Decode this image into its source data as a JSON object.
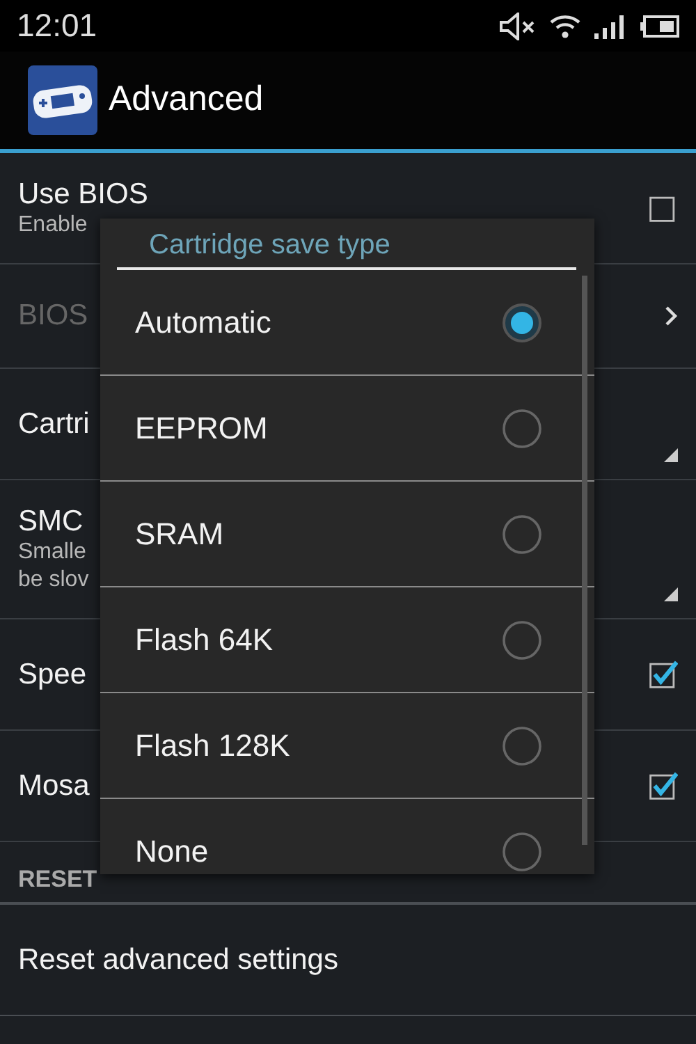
{
  "status_bar": {
    "time": "12:01"
  },
  "action_bar": {
    "title": "Advanced"
  },
  "settings": [
    {
      "kind": "checkbox",
      "title": "Use BIOS",
      "summary": [
        "Enable"
      ],
      "checked": false,
      "disabled": false
    },
    {
      "kind": "link",
      "title": "BIOS",
      "disabled": true
    },
    {
      "kind": "list",
      "title": "Cartri",
      "disabled": false
    },
    {
      "kind": "list",
      "title": "SMC",
      "summary": [
        "Smalle",
        "be slov"
      ],
      "disabled": false
    },
    {
      "kind": "checkbox",
      "title": "Spee",
      "checked": true,
      "disabled": false
    },
    {
      "kind": "checkbox",
      "title": "Mosa",
      "checked": true,
      "disabled": false
    },
    {
      "kind": "header",
      "title": "RESET"
    },
    {
      "kind": "action",
      "title": "Reset advanced settings",
      "disabled": false
    }
  ],
  "dialog": {
    "title": "Cartridge save type",
    "options": [
      {
        "label": "Automatic",
        "selected": true
      },
      {
        "label": "EEPROM",
        "selected": false
      },
      {
        "label": "SRAM",
        "selected": false
      },
      {
        "label": "Flash 64K",
        "selected": false
      },
      {
        "label": "Flash 128K",
        "selected": false
      },
      {
        "label": "None",
        "selected": false
      }
    ]
  }
}
